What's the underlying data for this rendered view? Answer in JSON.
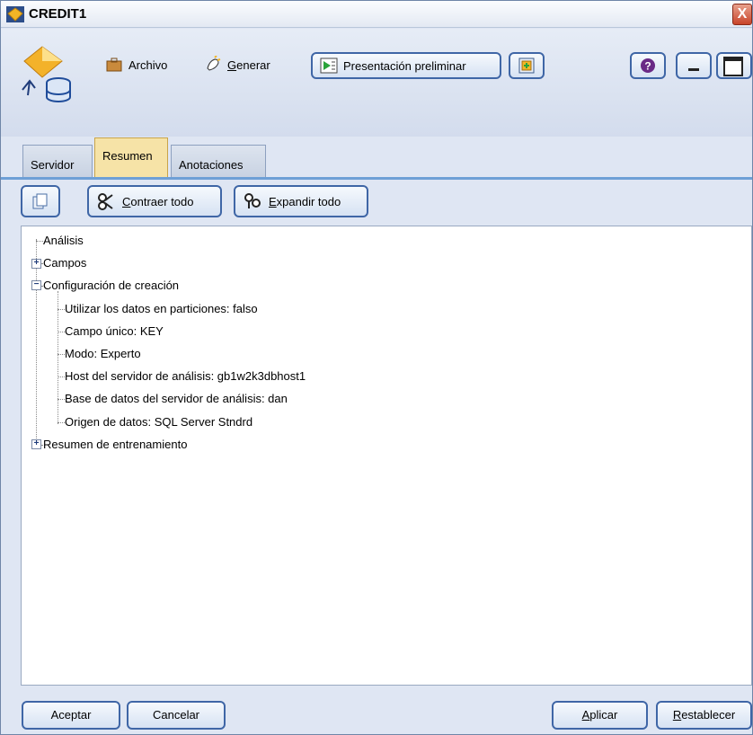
{
  "window": {
    "title": "CREDIT1",
    "close": "X"
  },
  "toolbar": {
    "archivo": "Archivo",
    "generar": "Generar",
    "presentacion": "Presentación preliminar"
  },
  "tabs": [
    "Servidor",
    "Resumen",
    "Anotaciones"
  ],
  "subtoolbar": {
    "contraer": "Contraer todo",
    "expandir": "Expandir todo"
  },
  "tree": {
    "analisis": "Análisis",
    "campos": "Campos",
    "config": "Configuración de creación",
    "children": [
      "Utilizar los datos en particiones: falso",
      "Campo único: KEY",
      "Modo: Experto",
      "Host del servidor de análisis: gb1w2k3dbhost1",
      "Base de datos del servidor de análisis: dan",
      "Origen de datos: SQL Server Stndrd"
    ],
    "resumen": "Resumen de entrenamiento"
  },
  "buttons": {
    "aceptar": "Aceptar",
    "cancelar": "Cancelar",
    "aplicar": "Aplicar",
    "restablecer": "Restablecer"
  }
}
